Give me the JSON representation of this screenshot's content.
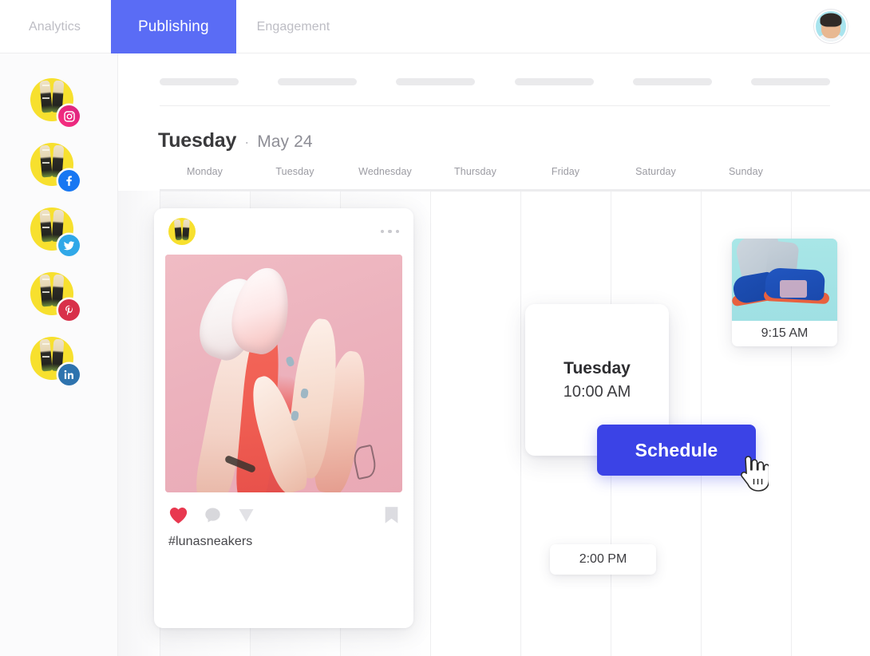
{
  "topbar": {
    "tabs": [
      {
        "label": "Analytics",
        "active": false
      },
      {
        "label": "Publishing",
        "active": true
      },
      {
        "label": "Engagement",
        "active": false
      }
    ],
    "avatar_name": "user-avatar"
  },
  "sidebar": {
    "accounts": [
      {
        "platform": "instagram",
        "icon": "instagram-icon"
      },
      {
        "platform": "facebook",
        "icon": "facebook-icon"
      },
      {
        "platform": "twitter",
        "icon": "twitter-icon"
      },
      {
        "platform": "pinterest",
        "icon": "pinterest-icon"
      },
      {
        "platform": "linkedin",
        "icon": "linkedin-icon"
      }
    ]
  },
  "calendar": {
    "header_day": "Tuesday",
    "header_separator": "·",
    "header_date": "May 24",
    "day_columns": [
      "Monday",
      "Tuesday",
      "Wednesday",
      "Thursday",
      "Friday",
      "Saturday",
      "Sunday"
    ]
  },
  "post_card": {
    "menu_icon": "more-options-icon",
    "avatar_icon": "account-avatar",
    "image_alt": "sneakers-pink-photo",
    "actions": [
      {
        "name": "like-icon",
        "state": "liked"
      },
      {
        "name": "comment-icon",
        "state": "default"
      },
      {
        "name": "share-icon",
        "state": "default"
      },
      {
        "name": "bookmark-icon",
        "state": "default"
      }
    ],
    "caption": "#lunasneakers"
  },
  "schedule_popup": {
    "day": "Tuesday",
    "time": "10:00 AM",
    "button_label": "Schedule",
    "cursor_icon": "pointer-hand-cursor"
  },
  "slots": [
    {
      "time": "9:15 AM",
      "has_image": true,
      "image_alt": "blue-sneakers-photo"
    },
    {
      "time": "2:00 PM",
      "has_image": false
    }
  ],
  "colors": {
    "accent": "#5a6cf5",
    "button": "#3b43e6",
    "tab_inactive_text": "#bdbdc4",
    "heart": "#e8384f",
    "avatar_yellow": "#f7e02e",
    "post_bg": "#efb9c1",
    "slot_bg": "#a6e4e6"
  }
}
